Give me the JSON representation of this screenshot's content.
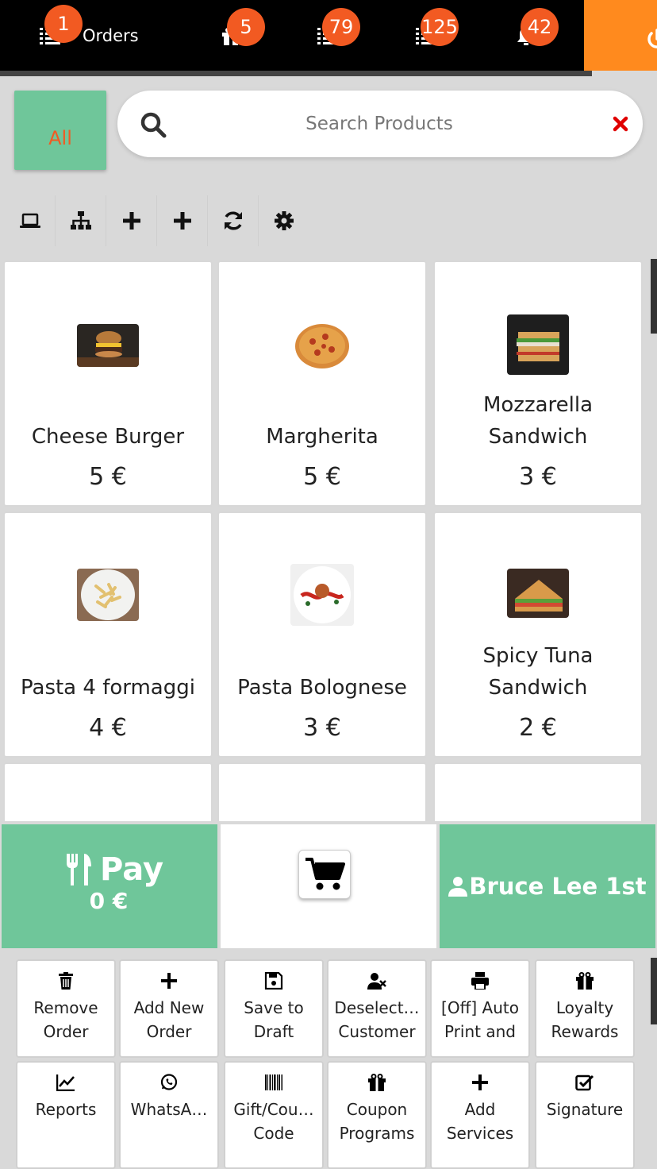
{
  "topbar": {
    "orders_label": "Orders",
    "badges": [
      "1",
      "5",
      "79",
      "125",
      "42"
    ],
    "colors": {
      "bar": "#000000",
      "badge": "#f25a22",
      "power": "#ff8a1e"
    }
  },
  "filter": {
    "all_label": "All"
  },
  "search": {
    "placeholder": "Search Products",
    "value": ""
  },
  "toolbar": {
    "icons": [
      "laptop-icon",
      "sitemap-icon",
      "plus-icon",
      "plus-icon",
      "refresh-icon",
      "gear-icon"
    ]
  },
  "products": [
    {
      "name": "Cheese Burger",
      "price": "5 €"
    },
    {
      "name": "Margherita",
      "price": "5 €"
    },
    {
      "name": "Mozzarella Sandwich",
      "price": "3 €"
    },
    {
      "name": "Pasta 4 formaggi",
      "price": "4 €"
    },
    {
      "name": "Pasta Bolognese",
      "price": "3 €"
    },
    {
      "name": "Spicy Tuna Sandwich",
      "price": "2 €"
    }
  ],
  "checkout": {
    "pay_label": "Pay",
    "pay_amount": "0 €",
    "customer_name": "Bruce Lee 1st",
    "accent": "#6fc69a"
  },
  "actions": [
    {
      "label": "Remove\nOrder"
    },
    {
      "label": "Add New\nOrder"
    },
    {
      "label": "Save to\nDraft"
    },
    {
      "label": "Deselect…\nCustomer"
    },
    {
      "label": "[Off] Auto\nPrint and"
    },
    {
      "label": "Loyalty\nRewards"
    },
    {
      "label": "Reports"
    },
    {
      "label": "WhatsA…"
    },
    {
      "label": "Gift/Cou…\nCode"
    },
    {
      "label": "Coupon\nPrograms"
    },
    {
      "label": "Add\nServices"
    },
    {
      "label": "Signature"
    }
  ]
}
